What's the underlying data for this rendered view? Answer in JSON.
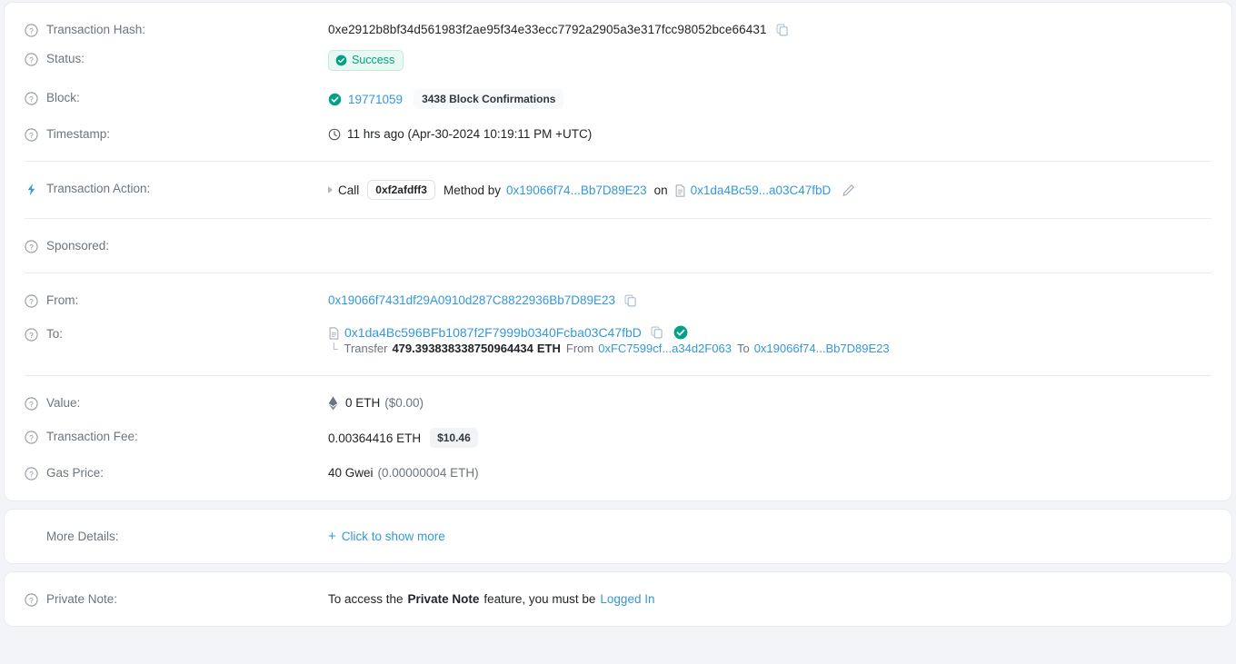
{
  "colors": {
    "link": "#3498db",
    "success_text": "#00a186",
    "success_bg": "#e8f8f2",
    "page_bg": "#f2f4f7",
    "muted": "#6c757d",
    "bolt": "#3498db"
  },
  "rows": {
    "transaction_hash": {
      "label": "Transaction Hash:",
      "value": "0xe2912b8bf34d561983f2ae95f34e33ecc7792a2905a3e317fcc98052bce66431",
      "icon": "help-circle-icon",
      "copy_icon": "copy-icon"
    },
    "status": {
      "label": "Status:",
      "value": "Success",
      "icon": "help-circle-icon",
      "badge_icon": "check-circle-icon"
    },
    "block": {
      "label": "Block:",
      "number": "19771059",
      "confirmations": "3438 Block Confirmations",
      "icon": "help-circle-icon",
      "block_icon": "check-circle-icon"
    },
    "timestamp": {
      "label": "Timestamp:",
      "value": "11 hrs ago (Apr-30-2024 10:19:11 PM +UTC)",
      "icon": "help-circle-icon",
      "clock_icon": "clock-icon"
    },
    "transaction_action": {
      "label": "Transaction Action:",
      "icon": "lightning-bolt-icon",
      "caret_icon": "caret-right-icon",
      "call_text": "Call",
      "method_id": "0xf2afdff3",
      "method_by_text": "Method by",
      "by_address": "0x19066f74...Bb7D89E23",
      "on_text": "on",
      "contract_icon": "document-icon",
      "on_address": "0x1da4Bc59...a03C47fbD",
      "edit_icon": "pencil-icon"
    },
    "sponsored": {
      "label": "Sponsored:",
      "icon": "help-circle-icon",
      "value": ""
    },
    "from": {
      "label": "From:",
      "value": "0x19066f7431df29A0910d287C8822936Bb7D89E23",
      "icon": "help-circle-icon",
      "copy_icon": "copy-icon"
    },
    "to": {
      "label": "To:",
      "value": "0x1da4Bc596BFb1087f2F7999b0340Fcba03C47fbD",
      "icon": "help-circle-icon",
      "contract_icon": "document-icon",
      "copy_icon": "copy-icon",
      "verified_icon": "check-circle-icon",
      "transfer": {
        "corner_icon": "corner-arrow-icon",
        "transfer_text": "Transfer",
        "amount": "479.393838338750964434",
        "unit": "ETH",
        "from_text": "From",
        "from_address": "0xFC7599cf...a34d2F063",
        "to_text": "To",
        "to_address": "0x19066f74...Bb7D89E23"
      }
    },
    "value": {
      "label": "Value:",
      "icon": "help-circle-icon",
      "eth_icon": "ethereum-icon",
      "amount": "0 ETH",
      "usd": "($0.00)"
    },
    "transaction_fee": {
      "label": "Transaction Fee:",
      "icon": "help-circle-icon",
      "amount": "0.00364416 ETH",
      "usd_badge": "$10.46"
    },
    "gas_price": {
      "label": "Gas Price:",
      "icon": "help-circle-icon",
      "amount": "40 Gwei",
      "eth_equiv": "(0.00000004 ETH)"
    },
    "more_details": {
      "label": "More Details:",
      "plus_icon": "plus-icon",
      "link_text": "Click to show more"
    },
    "private_note": {
      "label": "Private Note:",
      "icon": "help-circle-icon",
      "text_before": "To access the",
      "bold_text": "Private Note",
      "text_middle": "feature, you must be",
      "link_text": "Logged In"
    }
  }
}
